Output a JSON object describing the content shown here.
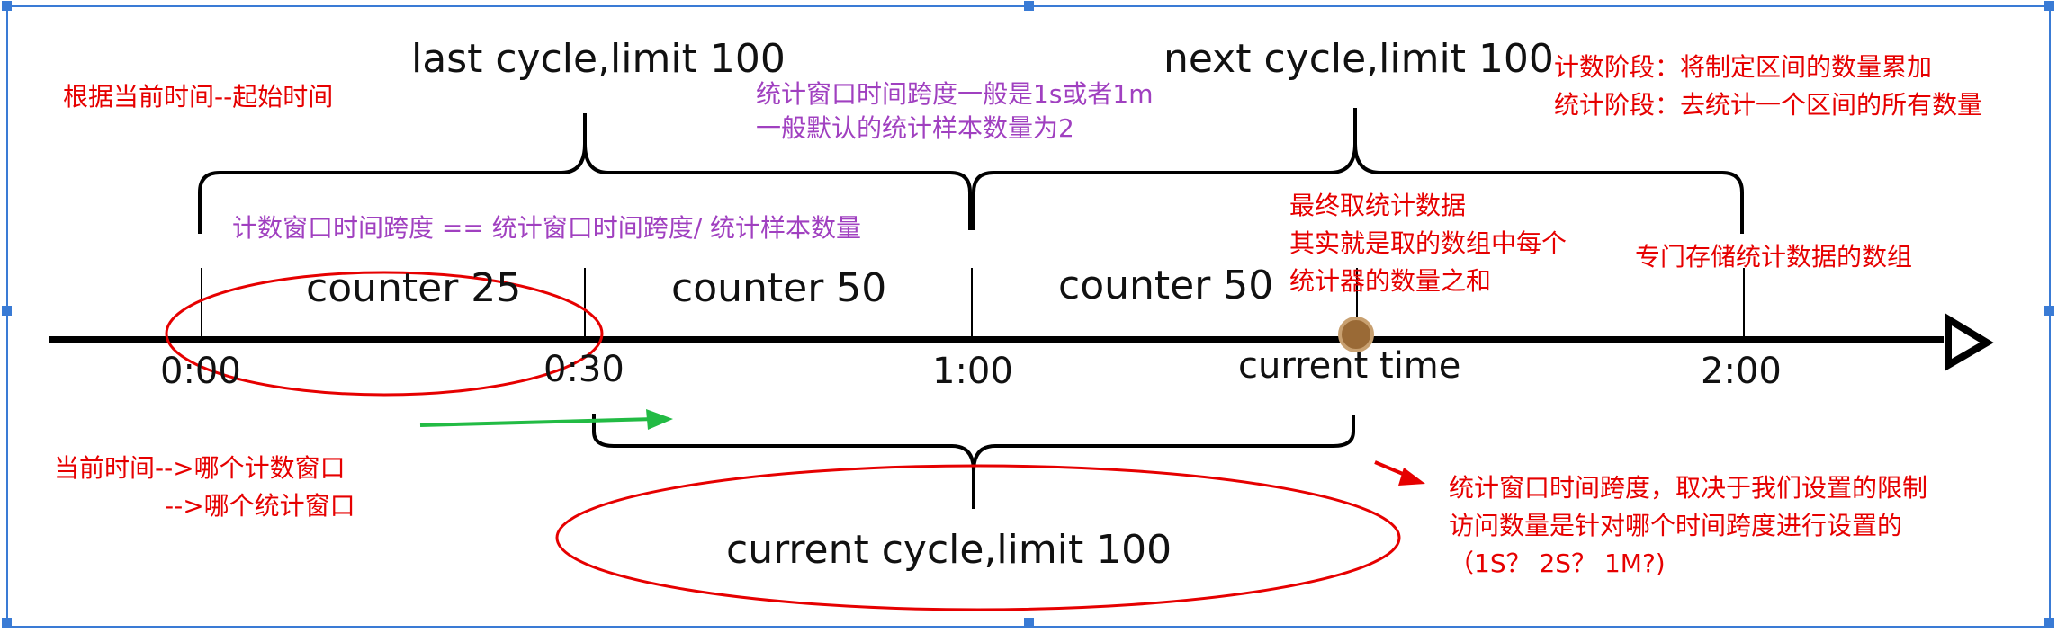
{
  "colors": {
    "red": "#e60000",
    "purple": "#a040c0",
    "green": "#22bb44",
    "axis": "#000000",
    "marker": "#9a6a36",
    "selection": "#3a7bd5"
  },
  "cycles": {
    "last": "last cycle,limit 100",
    "next": "next cycle,limit 100",
    "current": "current cycle,limit 100"
  },
  "counters": [
    "counter 25",
    "counter 50",
    "counter 50"
  ],
  "ticks": [
    "0:00",
    "0:30",
    "1:00",
    "current time",
    "2:00"
  ],
  "notes": {
    "start_time": "根据当前时间--起始时间",
    "stat_window": [
      "统计窗口时间跨度一般是1s或者1m",
      "一般默认的统计样本数量为2"
    ],
    "count_window": "计数窗口时间跨度 == 统计窗口时间跨度/ 统计样本数量",
    "phases": [
      "计数阶段：将制定区间的数量累加",
      "统计阶段：去统计一个区间的所有数量"
    ],
    "final_stats": [
      "最终取统计数据",
      "其实就是取的数组中每个",
      "统计器的数量之和"
    ],
    "array": "专门存储统计数据的数组",
    "current_time_map": [
      "当前时间-->哪个计数窗口",
      "-->哪个统计窗口"
    ],
    "span_depends": [
      "统计窗口时间跨度，取决于我们设置的限制",
      "访问数量是针对哪个时间跨度进行设置的",
      "（1S？ 2S？ 1M?)"
    ]
  }
}
